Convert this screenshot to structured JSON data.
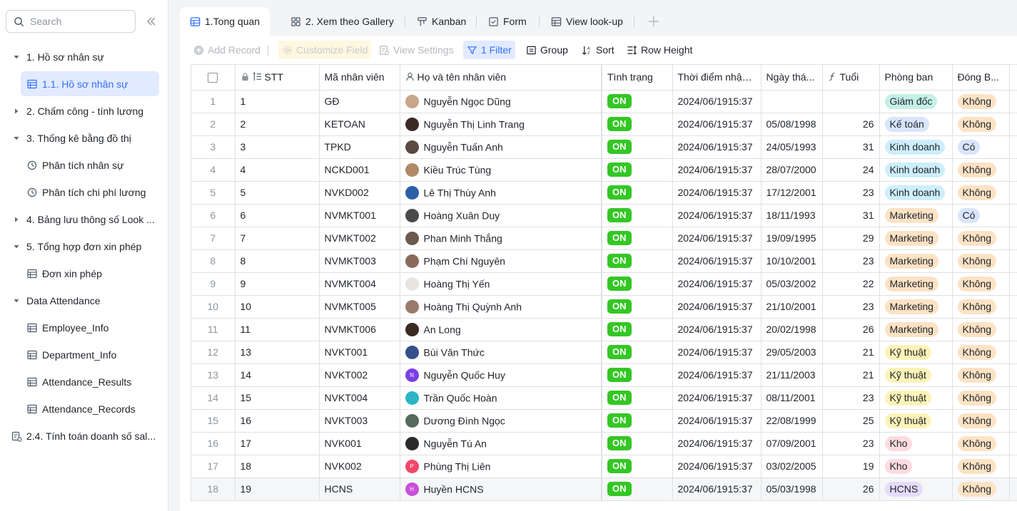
{
  "sidebar": {
    "search_placeholder": "Search",
    "items": [
      {
        "label": "1. Hồ sơ nhân sự",
        "level": 0,
        "expanded": true
      },
      {
        "label": "1.1. Hồ sơ nhân sự",
        "level": 1,
        "icon": "table-icon",
        "active": true
      },
      {
        "label": "2. Chấm công - tính lương",
        "level": 0,
        "expanded": false
      },
      {
        "label": "3. Thống kê bằng đồ thị",
        "level": 0,
        "expanded": true
      },
      {
        "label": "Phân tích nhân sự",
        "level": 1,
        "icon": "dashboard-icon"
      },
      {
        "label": "Phân tích chi phí lương",
        "level": 1,
        "icon": "dashboard-icon"
      },
      {
        "label": "4. Bảng lưu thông số Look ...",
        "level": 0,
        "expanded": false
      },
      {
        "label": "5. Tổng hợp đơn xin phép",
        "level": 0,
        "expanded": true
      },
      {
        "label": "Đơn xin phép",
        "level": 1,
        "icon": "table-icon"
      },
      {
        "label": "Data Attendance",
        "level": 0,
        "expanded": true
      },
      {
        "label": "Employee_Info",
        "level": 1,
        "icon": "table-icon"
      },
      {
        "label": "Department_Info",
        "level": 1,
        "icon": "table-icon"
      },
      {
        "label": "Attendance_Results",
        "level": 1,
        "icon": "table-icon"
      },
      {
        "label": "Attendance_Records",
        "level": 1,
        "icon": "table-icon"
      },
      {
        "label": "2.4. Tính toán doanh số sal...",
        "level": 0,
        "icon": "workflow-doc-icon"
      }
    ]
  },
  "tabs": [
    {
      "label": "1.Tong quan",
      "icon": "grid-icon",
      "active": true
    },
    {
      "label": "2. Xem theo Gallery",
      "icon": "gallery-icon"
    },
    {
      "label": "Kanban",
      "icon": "kanban-icon"
    },
    {
      "label": "Form",
      "icon": "form-icon"
    },
    {
      "label": "View look-up",
      "icon": "grid-icon"
    }
  ],
  "toolbar": {
    "add_record": "Add Record",
    "customize_field": "Customize Field",
    "view_settings": "View Settings",
    "filter": "1 Filter",
    "group": "Group",
    "sort": "Sort",
    "row_height": "Row Height"
  },
  "columns": {
    "stt": "STT",
    "ma_nv": "Mã nhân viên",
    "ho_ten": "Họ và tên nhân viên",
    "tinh_trang": "Tình trạng",
    "thoi_diem": "Thời điểm nhập...",
    "ngay_thang": "Ngày thá...",
    "tuoi": "Tuổi",
    "phong_ban": "Phòng ban",
    "dong_bh": "Đóng B..."
  },
  "colors": {
    "accent": "#3370ff",
    "on_green": "#34c724",
    "dept_giam_doc": "#c4f0e6",
    "dept_ke_toan": "#d9e4ff",
    "dept_kinh_doanh": "#cdeefc",
    "dept_marketing": "#fde2c4",
    "dept_ky_thuat": "#fdf3b8",
    "dept_kho": "#fddbe0",
    "dept_hcns": "#e6dbfb",
    "bh_khong": "#fde2c4",
    "bh_co": "#d9e4ff"
  },
  "rows": [
    {
      "rn": "1",
      "stt": "1",
      "ma": "GĐ",
      "ten": "Nguyễn Ngọc Dũng",
      "status": "ON",
      "td": "2024/06/1915:37",
      "ngay": "",
      "tuoi": "",
      "pb": "Giám đốc",
      "pb_key": "dept_giam_doc",
      "bh": "Không",
      "bh_key": "bh_khong",
      "av": "#c9a58a",
      "av_t": ""
    },
    {
      "rn": "2",
      "stt": "2",
      "ma": "KETOAN",
      "ten": "Nguyễn Thị Linh Trang",
      "status": "ON",
      "td": "2024/06/1915:37",
      "ngay": "05/08/1998",
      "tuoi": "26",
      "pb": "Kế toán",
      "pb_key": "dept_ke_toan",
      "bh": "Không",
      "bh_key": "bh_khong",
      "av": "#3a2b25",
      "av_t": ""
    },
    {
      "rn": "3",
      "stt": "3",
      "ma": "TPKD",
      "ten": "Nguyễn Tuấn Anh",
      "status": "ON",
      "td": "2024/06/1915:37",
      "ngay": "24/05/1993",
      "tuoi": "31",
      "pb": "Kinh doanh",
      "pb_key": "dept_kinh_doanh",
      "bh": "Có",
      "bh_key": "bh_co",
      "av": "#5a4a42",
      "av_t": ""
    },
    {
      "rn": "4",
      "stt": "4",
      "ma": "NCKD001",
      "ten": "Kiều Trúc Tùng",
      "status": "ON",
      "td": "2024/06/1915:37",
      "ngay": "28/07/2000",
      "tuoi": "24",
      "pb": "Kinh doanh",
      "pb_key": "dept_kinh_doanh",
      "bh": "Không",
      "bh_key": "bh_khong",
      "av": "#b08a66",
      "av_t": ""
    },
    {
      "rn": "5",
      "stt": "5",
      "ma": "NVKD002",
      "ten": "Lê Thị Thùy Anh",
      "status": "ON",
      "td": "2024/06/1915:37",
      "ngay": "17/12/2001",
      "tuoi": "23",
      "pb": "Kinh doanh",
      "pb_key": "dept_kinh_doanh",
      "bh": "Không",
      "bh_key": "bh_khong",
      "av": "#2b5fa8",
      "av_t": ""
    },
    {
      "rn": "6",
      "stt": "6",
      "ma": "NVMKT001",
      "ten": "Hoàng Xuân Duy",
      "status": "ON",
      "td": "2024/06/1915:37",
      "ngay": "18/11/1993",
      "tuoi": "31",
      "pb": "Marketing",
      "pb_key": "dept_marketing",
      "bh": "Có",
      "bh_key": "bh_co",
      "av": "#4a4a4a",
      "av_t": ""
    },
    {
      "rn": "7",
      "stt": "7",
      "ma": "NVMKT002",
      "ten": "Phan Minh Thắng",
      "status": "ON",
      "td": "2024/06/1915:37",
      "ngay": "19/09/1995",
      "tuoi": "29",
      "pb": "Marketing",
      "pb_key": "dept_marketing",
      "bh": "Không",
      "bh_key": "bh_khong",
      "av": "#6b5a4e",
      "av_t": ""
    },
    {
      "rn": "8",
      "stt": "8",
      "ma": "NVMKT003",
      "ten": "Phạm Chí Nguyên",
      "status": "ON",
      "td": "2024/06/1915:37",
      "ngay": "10/10/2001",
      "tuoi": "23",
      "pb": "Marketing",
      "pb_key": "dept_marketing",
      "bh": "Không",
      "bh_key": "bh_khong",
      "av": "#8a6a5a",
      "av_t": ""
    },
    {
      "rn": "9",
      "stt": "9",
      "ma": "NVMKT004",
      "ten": "Hoàng Thị Yến",
      "status": "ON",
      "td": "2024/06/1915:37",
      "ngay": "05/03/2002",
      "tuoi": "22",
      "pb": "Marketing",
      "pb_key": "dept_marketing",
      "bh": "Không",
      "bh_key": "bh_khong",
      "av": "#e8e4e0",
      "av_t": ""
    },
    {
      "rn": "10",
      "stt": "10",
      "ma": "NVMKT005",
      "ten": "Hoàng Thị Quỳnh Anh",
      "status": "ON",
      "td": "2024/06/1915:37",
      "ngay": "21/10/2001",
      "tuoi": "23",
      "pb": "Marketing",
      "pb_key": "dept_marketing",
      "bh": "Không",
      "bh_key": "bh_khong",
      "av": "#9a7a6a",
      "av_t": ""
    },
    {
      "rn": "11",
      "stt": "11",
      "ma": "NVMKT006",
      "ten": "An Long",
      "status": "ON",
      "td": "2024/06/1915:37",
      "ngay": "20/02/1998",
      "tuoi": "26",
      "pb": "Marketing",
      "pb_key": "dept_marketing",
      "bh": "Không",
      "bh_key": "bh_khong",
      "av": "#3a2a22",
      "av_t": ""
    },
    {
      "rn": "12",
      "stt": "13",
      "ma": "NVKT001",
      "ten": "Bùi Văn Thức",
      "status": "ON",
      "td": "2024/06/1915:37",
      "ngay": "29/05/2003",
      "tuoi": "21",
      "pb": "Kỹ thuật",
      "pb_key": "dept_ky_thuat",
      "bh": "Không",
      "bh_key": "bh_khong",
      "av": "#35508a",
      "av_t": ""
    },
    {
      "rn": "13",
      "stt": "14",
      "ma": "NVKT002",
      "ten": "Nguyễn Quốc Huy",
      "status": "ON",
      "td": "2024/06/1915:37",
      "ngay": "21/11/2003",
      "tuoi": "21",
      "pb": "Kỹ thuật",
      "pb_key": "dept_ky_thuat",
      "bh": "Không",
      "bh_key": "bh_khong",
      "av": "#7b3fe4",
      "av_t": "N"
    },
    {
      "rn": "14",
      "stt": "15",
      "ma": "NVKT004",
      "ten": "Trần Quốc Hoàn",
      "status": "ON",
      "td": "2024/06/1915:37",
      "ngay": "08/11/2001",
      "tuoi": "23",
      "pb": "Kỹ thuật",
      "pb_key": "dept_ky_thuat",
      "bh": "Không",
      "bh_key": "bh_khong",
      "av": "#2bb5c4",
      "av_t": ""
    },
    {
      "rn": "15",
      "stt": "16",
      "ma": "NVKT003",
      "ten": "Dương Đình Ngọc",
      "status": "ON",
      "td": "2024/06/1915:37",
      "ngay": "22/08/1999",
      "tuoi": "25",
      "pb": "Kỹ thuật",
      "pb_key": "dept_ky_thuat",
      "bh": "Không",
      "bh_key": "bh_khong",
      "av": "#556a5a",
      "av_t": ""
    },
    {
      "rn": "16",
      "stt": "17",
      "ma": "NVK001",
      "ten": "Nguyễn Tú An",
      "status": "ON",
      "td": "2024/06/1915:37",
      "ngay": "07/09/2001",
      "tuoi": "23",
      "pb": "Kho",
      "pb_key": "dept_kho",
      "bh": "Không",
      "bh_key": "bh_khong",
      "av": "#2a2a2a",
      "av_t": ""
    },
    {
      "rn": "17",
      "stt": "18",
      "ma": "NVK002",
      "ten": "Phùng Thị Liên",
      "status": "ON",
      "td": "2024/06/1915:37",
      "ngay": "03/02/2005",
      "tuoi": "19",
      "pb": "Kho",
      "pb_key": "dept_kho",
      "bh": "Không",
      "bh_key": "bh_khong",
      "av": "#f0486a",
      "av_t": "P"
    },
    {
      "rn": "18",
      "stt": "19",
      "ma": "HCNS",
      "ten": "Huyền HCNS",
      "status": "ON",
      "td": "2024/06/1915:37",
      "ngay": "05/03/1998",
      "tuoi": "26",
      "pb": "HCNS",
      "pb_key": "dept_hcns",
      "bh": "Không",
      "bh_key": "bh_khong",
      "av": "#c94fd6",
      "av_t": "H"
    }
  ]
}
